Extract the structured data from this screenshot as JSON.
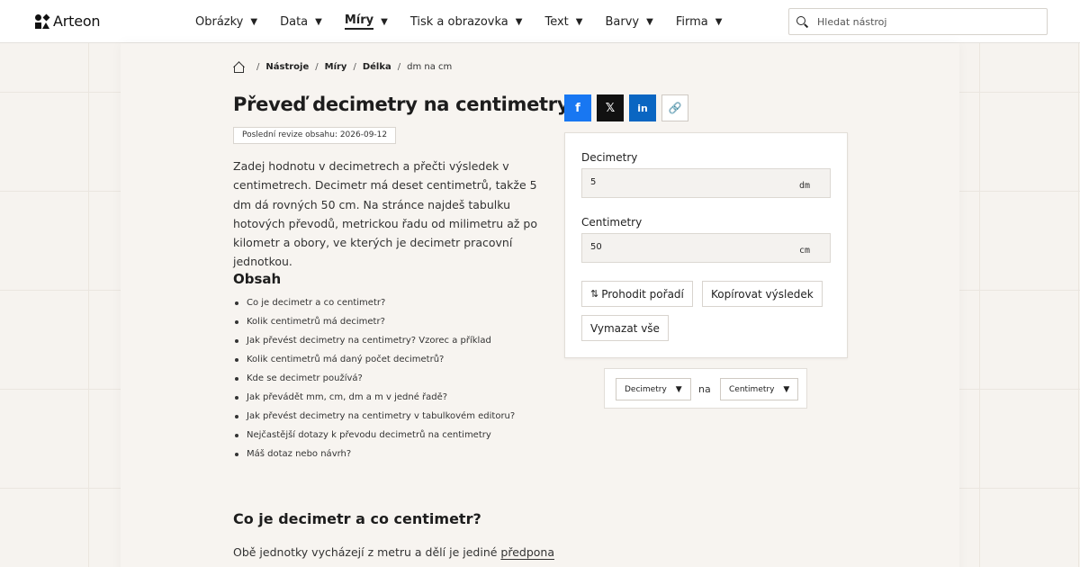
{
  "brand": {
    "name": "Arteon"
  },
  "nav": {
    "items": [
      {
        "label": "Obrázky",
        "active": false
      },
      {
        "label": "Data",
        "active": false
      },
      {
        "label": "Míry",
        "active": true
      },
      {
        "label": "Tisk a obrazovka",
        "active": false
      },
      {
        "label": "Text",
        "active": false
      },
      {
        "label": "Barvy",
        "active": false
      },
      {
        "label": "Firma",
        "active": false
      }
    ]
  },
  "search": {
    "placeholder": "Hledat nástroj"
  },
  "breadcrumb": {
    "items": [
      "Nástroje",
      "Míry",
      "Délka"
    ],
    "current": "dm na cm"
  },
  "page": {
    "title": "Převeď decimetry na centimetry",
    "revision": "Poslední revize obsahu: 2026-09-12",
    "intro": "Zadej hodnotu v decimetrech a přečti výsledek v centimetrech. Decimetr má deset centimetrů, takže 5 dm dá rovných 50 cm. Na stránce najdeš tabulku hotových převodů, metrickou řadu od milimetru až po kilometr a obory, ve kterých je decimetr pracovní jednotkou."
  },
  "toc": {
    "title": "Obsah",
    "items": [
      "Co je decimetr a co centimetr?",
      "Kolik centimetrů má decimetr?",
      "Jak převést decimetry na centimetry? Vzorec a příklad",
      "Kolik centimetrů má daný počet decimetrů?",
      "Kde se decimetr používá?",
      "Jak převádět mm, cm, dm a m v jedné řadě?",
      "Jak převést decimetry na centimetry v tabulkovém editoru?",
      "Nejčastější dotazy k převodu decimetrů na centimetry",
      "Máš dotaz nebo návrh?"
    ]
  },
  "section": {
    "title": "Co je decimetr a co centimetr?",
    "text_before": "Obě jednotky vycházejí z metru a dělí je jediné ",
    "link": "předpona"
  },
  "share": {
    "facebook_glyph": "f",
    "x_glyph": "𝕏",
    "linkedin_glyph": "in",
    "copy_glyph": "🔗"
  },
  "converter": {
    "from_label": "Decimetry",
    "from_value": "5",
    "from_unit": "dm",
    "to_label": "Centimetry",
    "to_value": "50",
    "to_unit": "cm",
    "swap_label": "Prohodit pořadí",
    "copy_label": "Kopírovat výsledek",
    "clear_label": "Vymazat vše"
  },
  "unit_picker": {
    "from": "Decimetry",
    "connector": "na",
    "to": "Centimetry"
  },
  "colors": {
    "facebook": "#1877f2",
    "x": "#111111",
    "linkedin": "#0a66c2"
  }
}
